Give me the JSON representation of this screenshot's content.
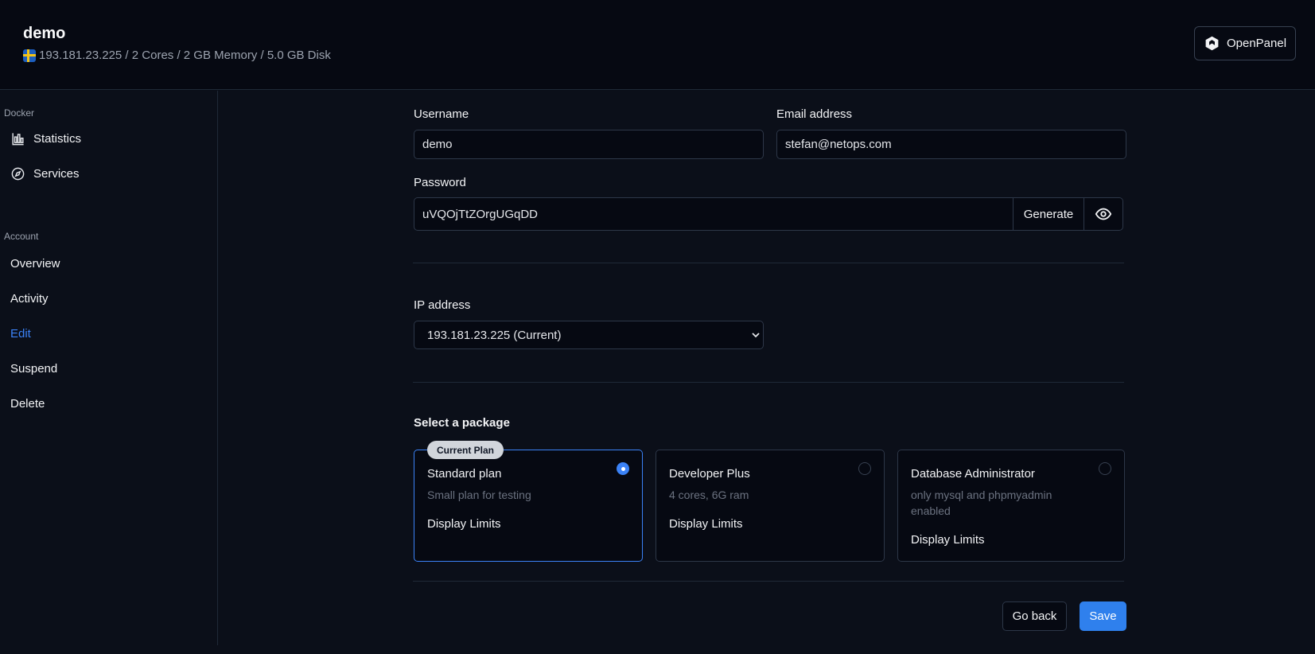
{
  "header": {
    "title": "demo",
    "subtitle": "193.181.23.225 / 2 Cores / 2 GB Memory / 5.0 GB Disk",
    "brand_label": "OpenPanel"
  },
  "sidebar": {
    "docker_label": "Docker",
    "docker_items": [
      {
        "label": "Statistics",
        "icon": "chart-bar-icon"
      },
      {
        "label": "Services",
        "icon": "compass-icon"
      }
    ],
    "account_label": "Account",
    "account_items": [
      {
        "label": "Overview"
      },
      {
        "label": "Activity"
      },
      {
        "label": "Edit",
        "active": true
      },
      {
        "label": "Suspend"
      },
      {
        "label": "Delete"
      }
    ]
  },
  "form": {
    "username_label": "Username",
    "username_value": "demo",
    "email_label": "Email address",
    "email_value": "stefan@netops.com",
    "password_label": "Password",
    "password_value": "uVQOjTtZOrgUGqDD",
    "generate_label": "Generate",
    "ip_label": "IP address",
    "ip_value": "193.181.23.225 (Current)"
  },
  "packages": {
    "heading": "Select a package",
    "current_badge": "Current Plan",
    "items": [
      {
        "name": "Standard plan",
        "desc": "Small plan for testing",
        "link": "Display Limits",
        "selected": true
      },
      {
        "name": "Developer Plus",
        "desc": "4 cores, 6G ram",
        "link": "Display Limits",
        "selected": false
      },
      {
        "name": "Database Administrator",
        "desc_line1": "only mysql and phpmyadmin",
        "desc_line2": "enabled",
        "link": "Display Limits",
        "selected": false
      }
    ]
  },
  "actions": {
    "back_label": "Go back",
    "save_label": "Save"
  },
  "colors": {
    "accent": "#3b82f6",
    "background": "#0b0f19"
  }
}
